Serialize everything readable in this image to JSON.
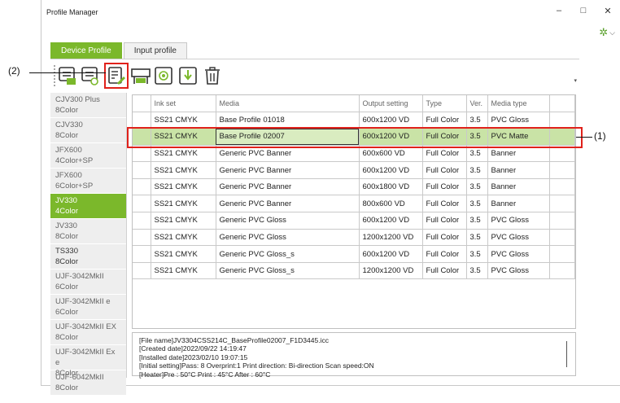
{
  "window": {
    "title": "Profile Manager",
    "controls": [
      "–",
      "□",
      "✕"
    ]
  },
  "tabs": [
    {
      "label": "Device Profile",
      "active": true
    },
    {
      "label": "Input profile",
      "active": false
    }
  ],
  "toolbar": {
    "icons": [
      "profile-list-icon",
      "profile-refresh-icon",
      "edit-profile-icon",
      "printer-icon",
      "color-target-icon",
      "import-icon",
      "trash-icon"
    ]
  },
  "sidebar": {
    "items": [
      {
        "line1": "CJV300 Plus",
        "line2": "8Color"
      },
      {
        "line1": "CJV330",
        "line2": "8Color"
      },
      {
        "line1": "JFX600",
        "line2": "4Color+SP"
      },
      {
        "line1": "JFX600",
        "line2": "6Color+SP"
      },
      {
        "line1": "JV330",
        "line2": "4Color"
      },
      {
        "line1": "JV330",
        "line2": "8Color"
      },
      {
        "line1": "TS330",
        "line2": "8Color"
      },
      {
        "line1": "UJF-3042MkII",
        "line2": "6Color"
      },
      {
        "line1": "UJF-3042MkII e",
        "line2": "6Color"
      },
      {
        "line1": "UJF-3042MkII EX",
        "line2": "8Color"
      },
      {
        "line1": "UJF-3042MkII Ex e",
        "line2": "8Color"
      },
      {
        "line1": "UJF-6042MkII",
        "line2": "8Color"
      }
    ],
    "selected_index": 4
  },
  "table": {
    "headers": [
      "Ink set",
      "Media",
      "Output setting",
      "Type",
      "Ver.",
      "Media type"
    ],
    "rows": [
      [
        "SS21 CMYK",
        "Base Profile 01018",
        "600x1200 VD",
        "Full Color",
        "3.5",
        "PVC Gloss"
      ],
      [
        "SS21 CMYK",
        "Base Profile 02007",
        "600x1200 VD",
        "Full Color",
        "3.5",
        "PVC Matte"
      ],
      [
        "SS21 CMYK",
        "Generic PVC Banner",
        "600x600 VD",
        "Full Color",
        "3.5",
        "Banner"
      ],
      [
        "SS21 CMYK",
        "Generic PVC Banner",
        "600x1200 VD",
        "Full Color",
        "3.5",
        "Banner"
      ],
      [
        "SS21 CMYK",
        "Generic PVC Banner",
        "600x1800 VD",
        "Full Color",
        "3.5",
        "Banner"
      ],
      [
        "SS21 CMYK",
        "Generic PVC Banner",
        "800x600 VD",
        "Full Color",
        "3.5",
        "Banner"
      ],
      [
        "SS21 CMYK",
        "Generic PVC Gloss",
        "600x1200 VD",
        "Full Color",
        "3.5",
        "PVC Gloss"
      ],
      [
        "SS21 CMYK",
        "Generic PVC Gloss",
        "1200x1200 VD",
        "Full Color",
        "3.5",
        "PVC Gloss"
      ],
      [
        "SS21 CMYK",
        "Generic PVC Gloss_s",
        "600x1200 VD",
        "Full Color",
        "3.5",
        "PVC Gloss"
      ],
      [
        "SS21 CMYK",
        "Generic PVC Gloss_s",
        "1200x1200 VD",
        "Full Color",
        "3.5",
        "PVC Gloss"
      ]
    ],
    "selected_row": 1
  },
  "info": {
    "lines": [
      "[File name]JV3304CSS214C_BaseProfile02007_F1D3445.icc",
      "[Created date]2022/09/22 14:19:47",
      "[Installed date]2023/02/10 19:07:15",
      "[Initial setting]Pass: 8 Overprint:1 Print direction: Bi-direction Scan speed:ON",
      "[Heater]Pre : 50°C Print : 45°C After : 60°C"
    ]
  },
  "callouts": {
    "one": "(1)",
    "two": "(2)"
  },
  "colors": {
    "accent": "#7bb82b",
    "highlight": "#e0211b",
    "row_selected": "#c9e3a6"
  }
}
